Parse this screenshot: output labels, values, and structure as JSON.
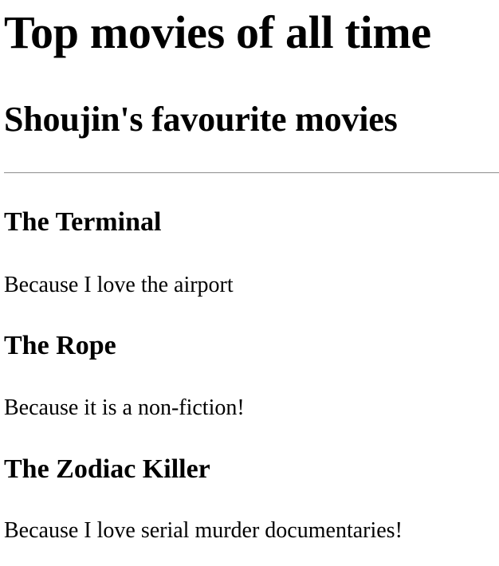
{
  "page": {
    "title": "Top movies of all time",
    "subtitle": "Shoujin's favourite movies"
  },
  "movies": [
    {
      "title": "The Terminal",
      "reason": "Because I love the airport"
    },
    {
      "title": "The Rope",
      "reason": "Because it is a non-fiction!"
    },
    {
      "title": "The Zodiac Killer",
      "reason": "Because I love serial murder documentaries!"
    }
  ]
}
